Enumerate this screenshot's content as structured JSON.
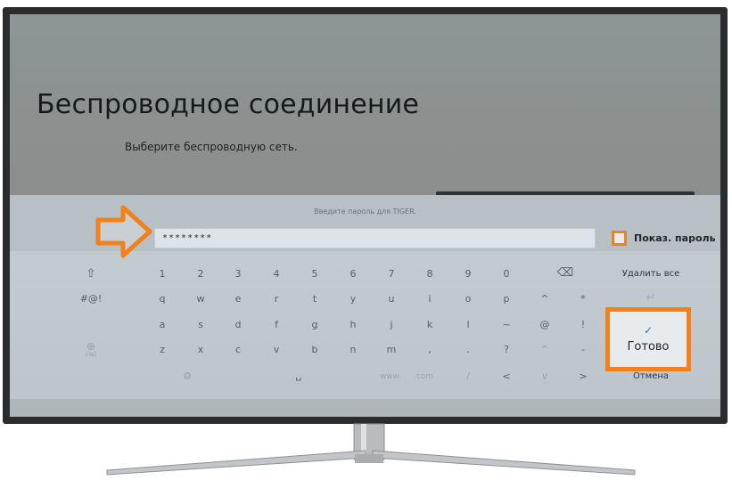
{
  "screen": {
    "title": "Беспроводное соединение",
    "subtitle": "Выберите беспроводную сеть."
  },
  "keyboard": {
    "prompt": "Введите пароль для TIGER.",
    "password_value": "********",
    "show_password_label": "Показ. пароль",
    "rows": [
      [
        "⇧",
        "1",
        "2",
        "3",
        "4",
        "5",
        "6",
        "7",
        "8",
        "9",
        "0",
        "⌫"
      ],
      [
        "#@!",
        "q",
        "w",
        "e",
        "r",
        "t",
        "y",
        "u",
        "i",
        "o",
        "p",
        "^",
        "*"
      ],
      [
        "a",
        "s",
        "d",
        "f",
        "g",
        "h",
        "j",
        "k",
        "l",
        "~",
        "@",
        "!"
      ],
      [
        "⊕",
        "z",
        "x",
        "c",
        "v",
        "b",
        "n",
        "m",
        ",",
        ".",
        "?",
        "^",
        "-"
      ],
      [
        "⚙",
        "␣",
        "www.",
        ".com",
        "/",
        "<",
        "∨",
        ">"
      ]
    ],
    "globe_label": "ENG",
    "actions": {
      "delete_all": "Удалить все",
      "enter": "↵",
      "done_check": "✓",
      "done": "Готово",
      "cancel": "Отмена"
    }
  },
  "colors": {
    "accent_orange": "#f2811c",
    "panel": "#c4cdd1",
    "check_blue": "#2b77c4"
  }
}
